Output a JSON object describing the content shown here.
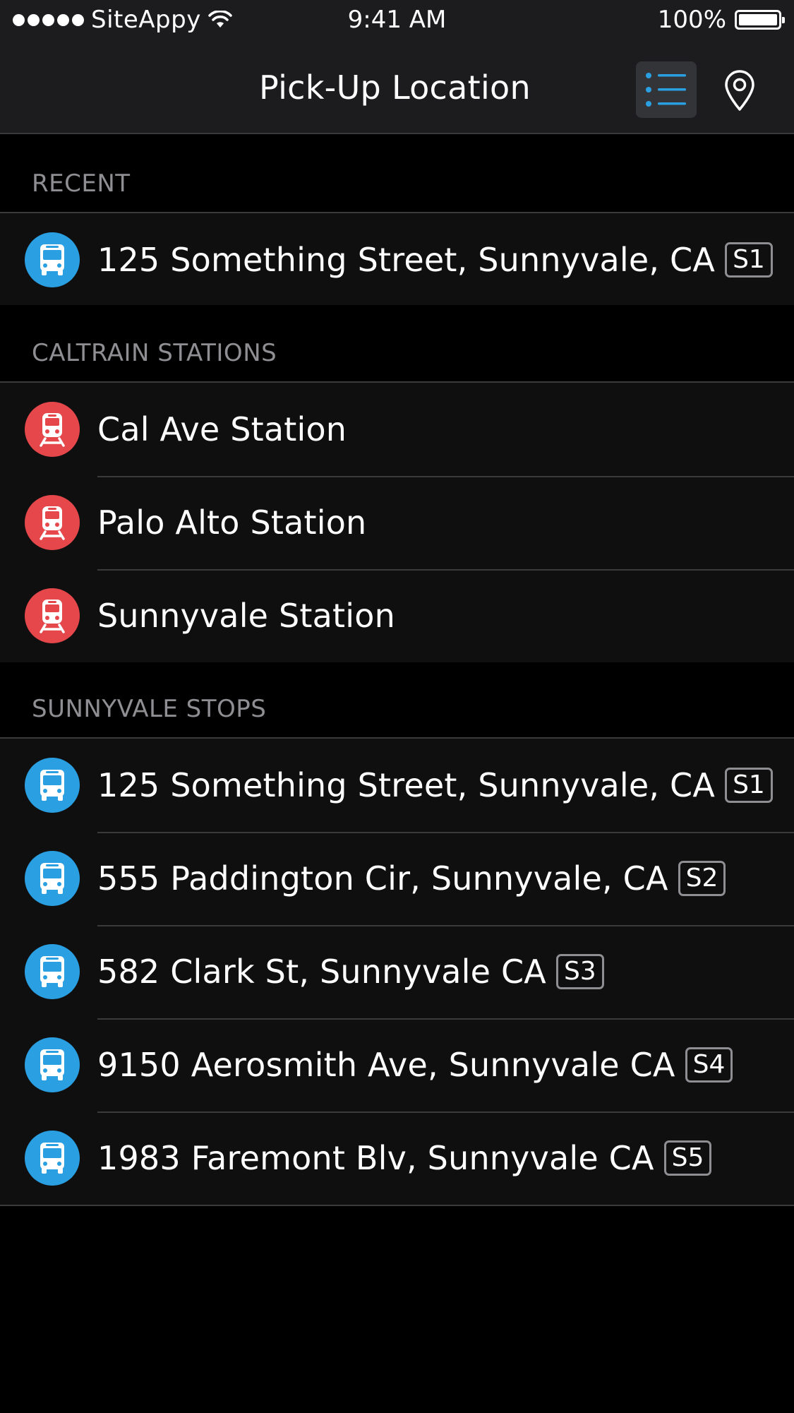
{
  "status_bar": {
    "carrier": "SiteAppy",
    "time": "9:41 AM",
    "battery": "100%",
    "signal_icon": "signal-dots-icon",
    "wifi_icon": "wifi-icon",
    "battery_icon": "battery-full-icon"
  },
  "nav": {
    "title": "Pick-Up Location",
    "list_view_icon": "list-icon",
    "map_view_icon": "map-pin-icon",
    "accent": "#2a9fe2"
  },
  "sections": [
    {
      "title": "RECENT",
      "items": [
        {
          "type": "bus",
          "icon": "bus-icon",
          "label": "125 Something Street, Sunnyvale, CA",
          "badge": "S1"
        }
      ]
    },
    {
      "title": "CALTRAIN STATIONS",
      "items": [
        {
          "type": "train",
          "icon": "train-icon",
          "label": "Cal Ave Station",
          "badge": ""
        },
        {
          "type": "train",
          "icon": "train-icon",
          "label": "Palo Alto Station",
          "badge": ""
        },
        {
          "type": "train",
          "icon": "train-icon",
          "label": "Sunnyvale Station",
          "badge": ""
        }
      ]
    },
    {
      "title": "SUNNYVALE STOPS",
      "items": [
        {
          "type": "bus",
          "icon": "bus-icon",
          "label": "125 Something Street, Sunnyvale, CA",
          "badge": "S1"
        },
        {
          "type": "bus",
          "icon": "bus-icon",
          "label": "555 Paddington Cir, Sunnyvale, CA",
          "badge": "S2"
        },
        {
          "type": "bus",
          "icon": "bus-icon",
          "label": "582 Clark St, Sunnyvale CA",
          "badge": "S3"
        },
        {
          "type": "bus",
          "icon": "bus-icon",
          "label": "9150 Aerosmith Ave, Sunnyvale CA",
          "badge": "S4"
        },
        {
          "type": "bus",
          "icon": "bus-icon",
          "label": "1983 Faremont Blv, Sunnyvale CA",
          "badge": "S5"
        }
      ]
    }
  ],
  "colors": {
    "bus": "#2a9fe2",
    "train": "#e5474b",
    "section_label": "#8e8e93"
  }
}
